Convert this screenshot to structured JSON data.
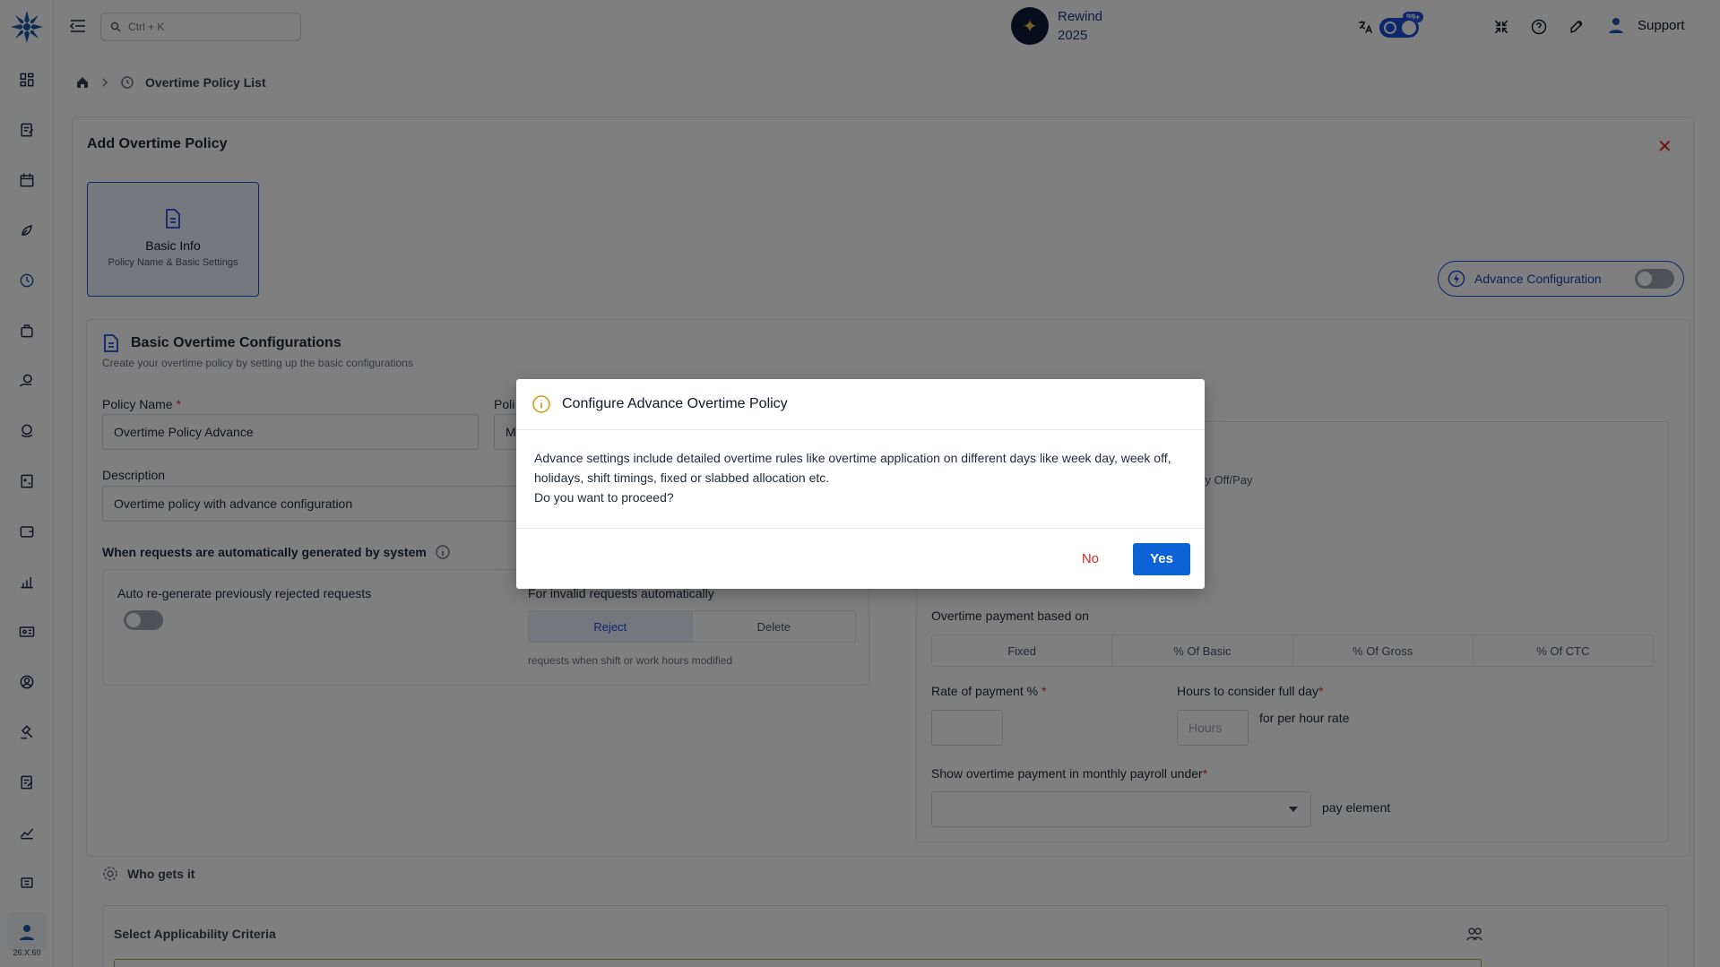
{
  "topbar": {
    "search_placeholder": "Ctrl + K",
    "rewind_line1": "Rewind",
    "rewind_line2": "2025",
    "notification_count": "99+",
    "support_label": "Support"
  },
  "sidebar": {
    "version": "26.X.60",
    "icons": [
      "dashboard-icon",
      "tasks-icon",
      "calendar-icon",
      "leave-icon",
      "overtime-icon",
      "bag-icon",
      "money-hand-icon",
      "coins-icon",
      "calculator-icon",
      "wallet-icon",
      "chart-icon",
      "id-card-icon",
      "profile-icon",
      "legal-icon",
      "review-icon",
      "analytics-icon",
      "switch-icon"
    ]
  },
  "breadcrumb": {
    "current": "Overtime Policy List"
  },
  "card": {
    "title": "Add Overtime Policy",
    "step": {
      "title": "Basic Info",
      "subtitle": "Policy Name & Basic Settings"
    },
    "advance_config_label": "Advance Configuration"
  },
  "section": {
    "title": "Basic Overtime Configurations",
    "subtitle": "Create your overtime policy by setting up the basic configurations",
    "policy_name_label": "Policy Name",
    "policy_name_value": "Overtime Policy Advance",
    "policy_second_label": "Poli",
    "policy_second_value": "M",
    "description_label": "Description",
    "description_value": "Overtime policy with advance configuration",
    "auto_gen_heading": "When requests are automatically generated by system",
    "auto_regen_label": "Auto re-generate previously rejected requests",
    "invalid_label": "For invalid requests automatically",
    "reject_label": "Reject",
    "delete_label": "Delete",
    "invalid_note": "requests when shift or work hours modified",
    "salary_partial": "ry Off/Pay",
    "payment_based_label": "Overtime payment based on",
    "payment_options": [
      "Fixed",
      "% Of Basic",
      "% Of Gross",
      "% Of CTC"
    ],
    "rate_label": "Rate of payment %",
    "hours_label": "Hours to consider full day",
    "hours_placeholder": "Hours",
    "per_hour_note": "for per hour rate",
    "payroll_label": "Show overtime payment in monthly payroll under",
    "pay_element_note": "pay element",
    "who_gets_label": "Who gets it",
    "applicability_label": "Select Applicability Criteria"
  },
  "dialog": {
    "title": "Configure Advance Overtime Policy",
    "body_line1": "Advance settings include detailed overtime rules like overtime application on different days like week day, week off, holidays, shift timings, fixed or slabbed allocation etc.",
    "body_line2": "Do you want to proceed?",
    "no_label": "No",
    "yes_label": "Yes"
  },
  "colors": {
    "primary": "#0b63d6",
    "danger": "#dc2626",
    "info": "#d4a017"
  }
}
